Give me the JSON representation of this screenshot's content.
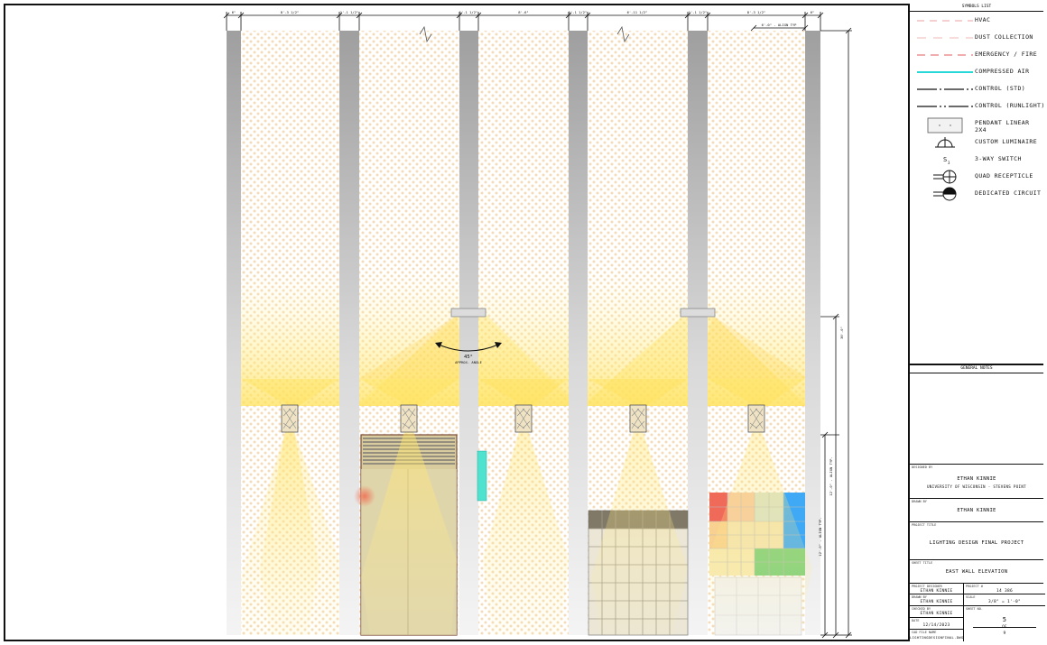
{
  "dimensions_top": [
    "6\"",
    "8'-3 1/2\"",
    "1'-1 1/2\"",
    "1'-1 1/2\"",
    "8'-6\"",
    "1'-1 1/2\"",
    "6'-11 1/2\"",
    "1'-1 1/2\"",
    "8'-3 1/2\"",
    "6\""
  ],
  "dimension_detail": "6'-0\" - ALIGN TYP",
  "dimensions_right": [
    "36'-0\"",
    "12'-0\" - ALIGN TYP.",
    "12'-0\" - ALIGN TYP."
  ],
  "annotation_angle": "45°",
  "annotation_caption": "APPROX. ANGLE",
  "legend": {
    "title": "SYMBOLS LIST",
    "items": [
      {
        "label": "HVAC",
        "icon": "dash-line-icon",
        "color": "#e9a0a0"
      },
      {
        "label": "DUST COLLECTION",
        "icon": "long-dash-line-icon",
        "color": "#f0b8b8"
      },
      {
        "label": "EMERGENCY / FIRE",
        "icon": "dash-line-icon",
        "color": "#e35b5b"
      },
      {
        "label": "COMPRESSED AIR",
        "icon": "solid-line-icon",
        "color": "#27d8d8"
      },
      {
        "label": "CONTROL (STD)",
        "icon": "dash-dot-line-icon",
        "color": "#111111"
      },
      {
        "label": "CONTROL (RUNLIGHT)",
        "icon": "dash-dot-dot-line-icon",
        "color": "#111111"
      },
      {
        "label": "PENDANT LINEAR 2X4",
        "icon": "pendant-linear-icon",
        "color": "#555555"
      },
      {
        "label": "CUSTOM LUMINAIRE",
        "icon": "custom-luminaire-icon",
        "color": "#111111"
      },
      {
        "label": "3-WAY SWITCH",
        "icon": "three-way-switch-icon",
        "symbol": "S",
        "subscript": "3",
        "color": "#111111"
      },
      {
        "label": "QUAD RECEPTICLE",
        "icon": "quad-receptacle-icon",
        "color": "#111111"
      },
      {
        "label": "DEDICATED CIRCUIT",
        "icon": "dedicated-circuit-icon",
        "color": "#111111"
      }
    ]
  },
  "generalnotes_title": "GENERAL NOTES",
  "designer": {
    "caption": "DESIGNED BY",
    "name": "ETHAN KINNIE",
    "school": "UNIVERSITY OF WISCONSIN - STEVENS POINT"
  },
  "drawn_by": {
    "caption": "DRAWN BY",
    "name": "ETHAN KINNIE"
  },
  "project": {
    "caption": "PROJECT TITLE",
    "name": "LIGHTING DESIGN FINAL PROJECT"
  },
  "sheet_title": {
    "caption": "SHEET TITLE",
    "name": "EAST WALL ELEVATION"
  },
  "grid": {
    "left": [
      {
        "caption": "PROJECT DESIGNER",
        "value": "ETHAN KINNIE"
      },
      {
        "caption": "DRAWN BY",
        "value": "ETHAN KINNIE"
      },
      {
        "caption": "CHECKED BY",
        "value": "ETHAN KINNIE"
      },
      {
        "caption": "DATE",
        "value": "12/14/2023"
      },
      {
        "caption": "CAD FILE NAME",
        "value": "LIGHTINGDESIGNFINAL.DWG"
      }
    ],
    "right": [
      {
        "caption": "PROJECT #",
        "value": "14 386"
      },
      {
        "caption": "SCALE",
        "value": "3/8\" = 1'-0\""
      },
      {
        "caption": "SHEET NO.",
        "value": "5"
      }
    ],
    "of_label": "OF",
    "total_sheets": "9"
  },
  "colors": {
    "light": "#ffe66b",
    "pattern": "#f2d4a6",
    "column": "#a9a9a9",
    "accent": "#4fe3cf",
    "red": "#f08770",
    "blue": "#3fa9f5",
    "green": "#7dd07a"
  }
}
